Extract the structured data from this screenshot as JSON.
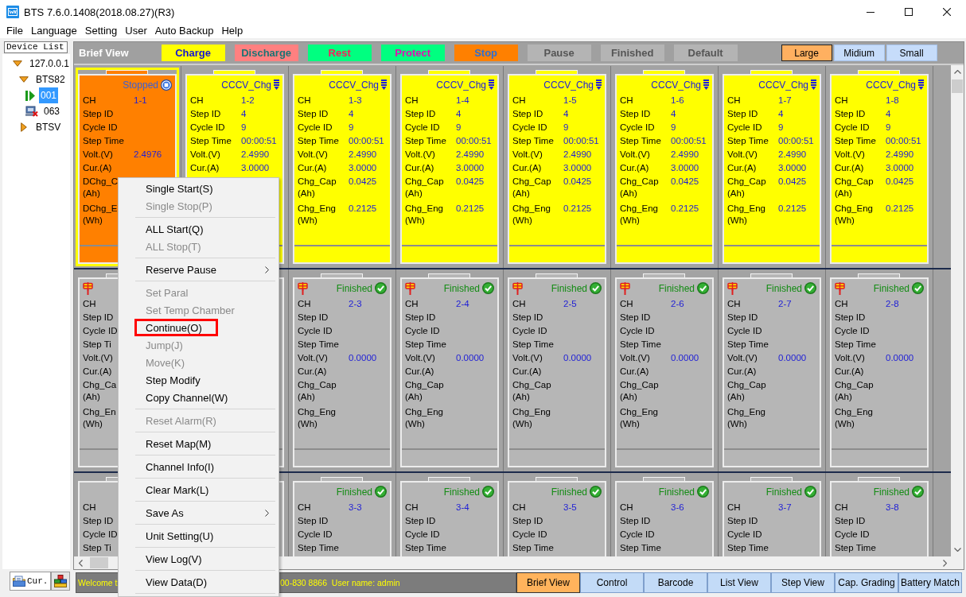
{
  "window": {
    "title": "BTS 7.6.0.1408(2018.08.27)(R3)"
  },
  "menu_bar": [
    "File",
    "Language",
    "Setting",
    "User",
    "Auto Backup",
    "Help"
  ],
  "device_list": {
    "title": "Device List",
    "tree": [
      {
        "label": "127.0.0.1",
        "expanded": true,
        "selected": false,
        "children": [
          {
            "label": "BTS82",
            "expanded": true,
            "selected": false,
            "children": [
              {
                "label": "001",
                "kind": "running",
                "selected": true
              },
              {
                "label": "063",
                "kind": "offline",
                "selected": false
              }
            ]
          },
          {
            "label": "BTSV",
            "expanded": false,
            "selected": false
          }
        ]
      }
    ],
    "tabs": [
      {
        "label": "Cur.",
        "kind": "folder",
        "selected": true
      },
      {
        "kind": "blocks",
        "selected": false
      }
    ]
  },
  "brief_view": {
    "title": "Brief View",
    "legend": [
      {
        "label": "Charge",
        "kind": "charge"
      },
      {
        "label": "Discharge",
        "kind": "discharge"
      },
      {
        "label": "Rest",
        "kind": "rest"
      },
      {
        "label": "Protect",
        "kind": "protect"
      },
      {
        "label": "Stop",
        "kind": "stop"
      },
      {
        "label": "Pause",
        "kind": "pause"
      },
      {
        "label": "Finished",
        "kind": "finished"
      },
      {
        "label": "Default",
        "kind": "default"
      }
    ],
    "sizes": [
      {
        "label": "Large",
        "selected": true
      },
      {
        "label": "Midium",
        "selected": false
      },
      {
        "label": "Small",
        "selected": false
      }
    ],
    "rows": [
      {
        "cards": [
          {
            "kind": "stop",
            "selected": true,
            "marked": false,
            "status": "Stopped",
            "fields": [
              {
                "label": "CH",
                "value": "1-1"
              },
              {
                "label": "Step ID"
              },
              {
                "label": "Cycle ID"
              },
              {
                "label": "Step Time"
              },
              {
                "label": "Volt.(V)",
                "value": "2.4976"
              },
              {
                "label": "Cur.(A)"
              },
              {
                "label": "DChg_C",
                "unit": "(Ah)"
              },
              {
                "label": "DChg_E",
                "unit": "(Wh)"
              }
            ]
          },
          {
            "kind": "charge",
            "selected": false,
            "marked": false,
            "status": "CCCV_Chg",
            "fields": [
              {
                "label": "CH",
                "value": "1-2"
              },
              {
                "label": "Step ID",
                "value": "4"
              },
              {
                "label": "Cycle ID",
                "value": "9"
              },
              {
                "label": "Step Time",
                "value": "00:00:51"
              },
              {
                "label": "Volt.(V)",
                "value": "2.4990"
              },
              {
                "label": "Cur.(A)",
                "value": "3.0000"
              }
            ]
          },
          {
            "kind": "charge",
            "selected": false,
            "marked": false,
            "status": "CCCV_Chg",
            "fields": [
              {
                "label": "CH",
                "value": "1-3"
              },
              {
                "label": "Step ID",
                "value": "4"
              },
              {
                "label": "Cycle ID",
                "value": "9"
              },
              {
                "label": "Step Time",
                "value": "00:00:51"
              },
              {
                "label": "Volt.(V)",
                "value": "2.4990"
              },
              {
                "label": "Cur.(A)",
                "value": "3.0000"
              },
              {
                "label": "Chg_Cap",
                "unit": "(Ah)",
                "value": "0.0425"
              },
              {
                "label": "Chg_Eng",
                "unit": "(Wh)",
                "value": "0.2125"
              }
            ]
          },
          {
            "kind": "charge",
            "selected": false,
            "marked": false,
            "status": "CCCV_Chg",
            "fields": [
              {
                "label": "CH",
                "value": "1-4"
              },
              {
                "label": "Step ID",
                "value": "4"
              },
              {
                "label": "Cycle ID",
                "value": "9"
              },
              {
                "label": "Step Time",
                "value": "00:00:51"
              },
              {
                "label": "Volt.(V)",
                "value": "2.4990"
              },
              {
                "label": "Cur.(A)",
                "value": "3.0000"
              },
              {
                "label": "Chg_Cap",
                "unit": "(Ah)",
                "value": "0.0425"
              },
              {
                "label": "Chg_Eng",
                "unit": "(Wh)",
                "value": "0.2125"
              }
            ]
          },
          {
            "kind": "charge",
            "selected": false,
            "marked": false,
            "status": "CCCV_Chg",
            "fields": [
              {
                "label": "CH",
                "value": "1-5"
              },
              {
                "label": "Step ID",
                "value": "4"
              },
              {
                "label": "Cycle ID",
                "value": "9"
              },
              {
                "label": "Step Time",
                "value": "00:00:51"
              },
              {
                "label": "Volt.(V)",
                "value": "2.4990"
              },
              {
                "label": "Cur.(A)",
                "value": "3.0000"
              },
              {
                "label": "Chg_Cap",
                "unit": "(Ah)",
                "value": "0.0425"
              },
              {
                "label": "Chg_Eng",
                "unit": "(Wh)",
                "value": "0.2125"
              }
            ]
          },
          {
            "kind": "charge",
            "selected": false,
            "marked": false,
            "status": "CCCV_Chg",
            "fields": [
              {
                "label": "CH",
                "value": "1-6"
              },
              {
                "label": "Step ID",
                "value": "4"
              },
              {
                "label": "Cycle ID",
                "value": "9"
              },
              {
                "label": "Step Time",
                "value": "00:00:51"
              },
              {
                "label": "Volt.(V)",
                "value": "2.4990"
              },
              {
                "label": "Cur.(A)",
                "value": "3.0000"
              },
              {
                "label": "Chg_Cap",
                "unit": "(Ah)",
                "value": "0.0425"
              },
              {
                "label": "Chg_Eng",
                "unit": "(Wh)",
                "value": "0.2125"
              }
            ]
          },
          {
            "kind": "charge",
            "selected": false,
            "marked": false,
            "status": "CCCV_Chg",
            "fields": [
              {
                "label": "CH",
                "value": "1-7"
              },
              {
                "label": "Step ID",
                "value": "4"
              },
              {
                "label": "Cycle ID",
                "value": "9"
              },
              {
                "label": "Step Time",
                "value": "00:00:51"
              },
              {
                "label": "Volt.(V)",
                "value": "2.4990"
              },
              {
                "label": "Cur.(A)",
                "value": "3.0000"
              },
              {
                "label": "Chg_Cap",
                "unit": "(Ah)",
                "value": "0.0425"
              },
              {
                "label": "Chg_Eng",
                "unit": "(Wh)",
                "value": "0.2125"
              }
            ]
          },
          {
            "kind": "charge",
            "selected": false,
            "marked": false,
            "status": "CCCV_Chg",
            "fields": [
              {
                "label": "CH",
                "value": "1-8"
              },
              {
                "label": "Step ID",
                "value": "4"
              },
              {
                "label": "Cycle ID",
                "value": "9"
              },
              {
                "label": "Step Time",
                "value": "00:00:51"
              },
              {
                "label": "Volt.(V)",
                "value": "2.4990"
              },
              {
                "label": "Cur.(A)",
                "value": "3.0000"
              },
              {
                "label": "Chg_Cap",
                "unit": "(Ah)",
                "value": "0.0425"
              },
              {
                "label": "Chg_Eng",
                "unit": "(Wh)",
                "value": "0.2125"
              }
            ]
          }
        ]
      },
      {
        "cards": [
          {
            "kind": "finished",
            "selected": false,
            "marked": true,
            "fields": [
              {
                "label": "CH"
              },
              {
                "label": "Step ID"
              },
              {
                "label": "Cycle ID"
              },
              {
                "label": "Step Ti"
              },
              {
                "label": "Volt.(V)"
              },
              {
                "label": "Cur.(A)"
              },
              {
                "label": "Chg_Ca",
                "unit": "(Ah)"
              },
              {
                "label": "Chg_En",
                "unit": "(Wh)"
              }
            ]
          },
          {
            "kind": "finished",
            "selected": false
          },
          {
            "kind": "finished",
            "selected": false,
            "marked": true,
            "status": "Finished",
            "fields": [
              {
                "label": "CH",
                "value": "2-3"
              },
              {
                "label": "Step ID"
              },
              {
                "label": "Cycle ID"
              },
              {
                "label": "Step Time"
              },
              {
                "label": "Volt.(V)",
                "value": "0.0000"
              },
              {
                "label": "Cur.(A)"
              },
              {
                "label": "Chg_Cap",
                "unit": "(Ah)"
              },
              {
                "label": "Chg_Eng",
                "unit": "(Wh)"
              }
            ]
          },
          {
            "kind": "finished",
            "selected": false,
            "marked": true,
            "status": "Finished",
            "fields": [
              {
                "label": "CH",
                "value": "2-4"
              },
              {
                "label": "Step ID"
              },
              {
                "label": "Cycle ID"
              },
              {
                "label": "Step Time"
              },
              {
                "label": "Volt.(V)",
                "value": "0.0000"
              },
              {
                "label": "Cur.(A)"
              },
              {
                "label": "Chg_Cap",
                "unit": "(Ah)"
              },
              {
                "label": "Chg_Eng",
                "unit": "(Wh)"
              }
            ]
          },
          {
            "kind": "finished",
            "selected": false,
            "marked": true,
            "status": "Finished",
            "fields": [
              {
                "label": "CH",
                "value": "2-5"
              },
              {
                "label": "Step ID"
              },
              {
                "label": "Cycle ID"
              },
              {
                "label": "Step Time"
              },
              {
                "label": "Volt.(V)",
                "value": "0.0000"
              },
              {
                "label": "Cur.(A)"
              },
              {
                "label": "Chg_Cap",
                "unit": "(Ah)"
              },
              {
                "label": "Chg_Eng",
                "unit": "(Wh)"
              }
            ]
          },
          {
            "kind": "finished",
            "selected": false,
            "marked": true,
            "status": "Finished",
            "fields": [
              {
                "label": "CH",
                "value": "2-6"
              },
              {
                "label": "Step ID"
              },
              {
                "label": "Cycle ID"
              },
              {
                "label": "Step Time"
              },
              {
                "label": "Volt.(V)",
                "value": "0.0000"
              },
              {
                "label": "Cur.(A)"
              },
              {
                "label": "Chg_Cap",
                "unit": "(Ah)"
              },
              {
                "label": "Chg_Eng",
                "unit": "(Wh)"
              }
            ]
          },
          {
            "kind": "finished",
            "selected": false,
            "marked": true,
            "status": "Finished",
            "fields": [
              {
                "label": "CH",
                "value": "2-7"
              },
              {
                "label": "Step ID"
              },
              {
                "label": "Cycle ID"
              },
              {
                "label": "Step Time"
              },
              {
                "label": "Volt.(V)",
                "value": "0.0000"
              },
              {
                "label": "Cur.(A)"
              },
              {
                "label": "Chg_Cap",
                "unit": "(Ah)"
              },
              {
                "label": "Chg_Eng",
                "unit": "(Wh)"
              }
            ]
          },
          {
            "kind": "finished",
            "selected": false,
            "marked": true,
            "status": "Finished",
            "fields": [
              {
                "label": "CH",
                "value": "2-8"
              },
              {
                "label": "Step ID"
              },
              {
                "label": "Cycle ID"
              },
              {
                "label": "Step Time"
              },
              {
                "label": "Volt.(V)",
                "value": "0.0000"
              },
              {
                "label": "Cur.(A)"
              },
              {
                "label": "Chg_Cap",
                "unit": "(Ah)"
              },
              {
                "label": "Chg_Eng",
                "unit": "(Wh)"
              }
            ]
          }
        ]
      },
      {
        "cards": [
          {
            "kind": "finished",
            "selected": false,
            "marked": false,
            "fields": [
              {
                "label": "CH"
              },
              {
                "label": "Step ID"
              },
              {
                "label": "Cycle ID"
              },
              {
                "label": "Step Ti"
              }
            ]
          },
          {
            "kind": "finished",
            "selected": false
          },
          {
            "kind": "finished",
            "selected": false,
            "marked": false,
            "status": "Finished",
            "fields": [
              {
                "label": "CH",
                "value": "3-3"
              },
              {
                "label": "Step ID"
              },
              {
                "label": "Cycle ID"
              },
              {
                "label": "Step Time"
              }
            ]
          },
          {
            "kind": "finished",
            "selected": false,
            "marked": false,
            "status": "Finished",
            "fields": [
              {
                "label": "CH",
                "value": "3-4"
              },
              {
                "label": "Step ID"
              },
              {
                "label": "Cycle ID"
              },
              {
                "label": "Step Time"
              }
            ]
          },
          {
            "kind": "finished",
            "selected": false,
            "marked": false,
            "status": "Finished",
            "fields": [
              {
                "label": "CH",
                "value": "3-5"
              },
              {
                "label": "Step ID"
              },
              {
                "label": "Cycle ID"
              },
              {
                "label": "Step Time"
              }
            ]
          },
          {
            "kind": "finished",
            "selected": false,
            "marked": false,
            "status": "Finished",
            "fields": [
              {
                "label": "CH",
                "value": "3-6"
              },
              {
                "label": "Step ID"
              },
              {
                "label": "Cycle ID"
              },
              {
                "label": "Step Time"
              }
            ]
          },
          {
            "kind": "finished",
            "selected": false,
            "marked": false,
            "status": "Finished",
            "fields": [
              {
                "label": "CH",
                "value": "3-7"
              },
              {
                "label": "Step ID"
              },
              {
                "label": "Cycle ID"
              },
              {
                "label": "Step Time"
              }
            ]
          },
          {
            "kind": "finished",
            "selected": false,
            "marked": false,
            "status": "Finished",
            "fields": [
              {
                "label": "CH",
                "value": "3-8"
              },
              {
                "label": "Step ID"
              },
              {
                "label": "Cycle ID"
              },
              {
                "label": "Step Time"
              }
            ]
          }
        ]
      }
    ]
  },
  "context_menu": {
    "groups": [
      {
        "items": [
          {
            "label": "Single Start(S)",
            "disabled": false,
            "submenu": false,
            "highlighted": false
          },
          {
            "label": "Single Stop(P)",
            "disabled": true,
            "submenu": false,
            "highlighted": false
          }
        ]
      },
      {
        "items": [
          {
            "label": "ALL Start(Q)",
            "disabled": false,
            "submenu": false,
            "highlighted": false
          },
          {
            "label": "ALL Stop(T)",
            "disabled": true,
            "submenu": false,
            "highlighted": false
          }
        ]
      },
      {
        "items": [
          {
            "label": "Reserve Pause",
            "disabled": false,
            "submenu": true,
            "highlighted": false
          }
        ]
      },
      {
        "items": [
          {
            "label": "Set Paral",
            "disabled": true,
            "submenu": false,
            "highlighted": false
          },
          {
            "label": "Set Temp Chamber",
            "disabled": true,
            "submenu": false,
            "highlighted": false
          },
          {
            "label": "Continue(O)",
            "disabled": false,
            "submenu": false,
            "highlighted": true
          },
          {
            "label": "Jump(J)",
            "disabled": true,
            "submenu": false,
            "highlighted": false
          },
          {
            "label": "Move(K)",
            "disabled": true,
            "submenu": false,
            "highlighted": false
          },
          {
            "label": "Step Modify",
            "disabled": false,
            "submenu": false,
            "highlighted": false
          },
          {
            "label": "Copy Channel(W)",
            "disabled": false,
            "submenu": false,
            "highlighted": false
          }
        ]
      },
      {
        "items": [
          {
            "label": "Reset Alarm(R)",
            "disabled": true,
            "submenu": false,
            "highlighted": false
          }
        ]
      },
      {
        "items": [
          {
            "label": "Reset Map(M)",
            "disabled": false,
            "submenu": false,
            "highlighted": false
          }
        ]
      },
      {
        "items": [
          {
            "label": "Channel Info(I)",
            "disabled": false,
            "submenu": false,
            "highlighted": false
          }
        ]
      },
      {
        "items": [
          {
            "label": "Clear Mark(L)",
            "disabled": false,
            "submenu": false,
            "highlighted": false
          }
        ]
      },
      {
        "items": [
          {
            "label": "Save As",
            "disabled": false,
            "submenu": true,
            "highlighted": false
          }
        ]
      },
      {
        "items": [
          {
            "label": "Unit Setting(U)",
            "disabled": false,
            "submenu": false,
            "highlighted": false
          }
        ]
      },
      {
        "items": [
          {
            "label": "View Log(V)",
            "disabled": false,
            "submenu": false,
            "highlighted": false
          }
        ]
      },
      {
        "items": [
          {
            "label": "View Data(D)",
            "disabled": false,
            "submenu": false,
            "highlighted": false
          }
        ]
      }
    ]
  },
  "status_bar": {
    "message_start": "Welcome t",
    "message_end": "00-830 8866  User name: admin"
  },
  "view_tabs": [
    {
      "label": "Brief View",
      "selected": true
    },
    {
      "label": "Control",
      "selected": false
    },
    {
      "label": "Barcode",
      "selected": false
    },
    {
      "label": "List View",
      "selected": false
    },
    {
      "label": "Step View",
      "selected": false
    },
    {
      "label": "Cap. Grading",
      "selected": false
    },
    {
      "label": "Battery Match",
      "selected": false
    }
  ]
}
